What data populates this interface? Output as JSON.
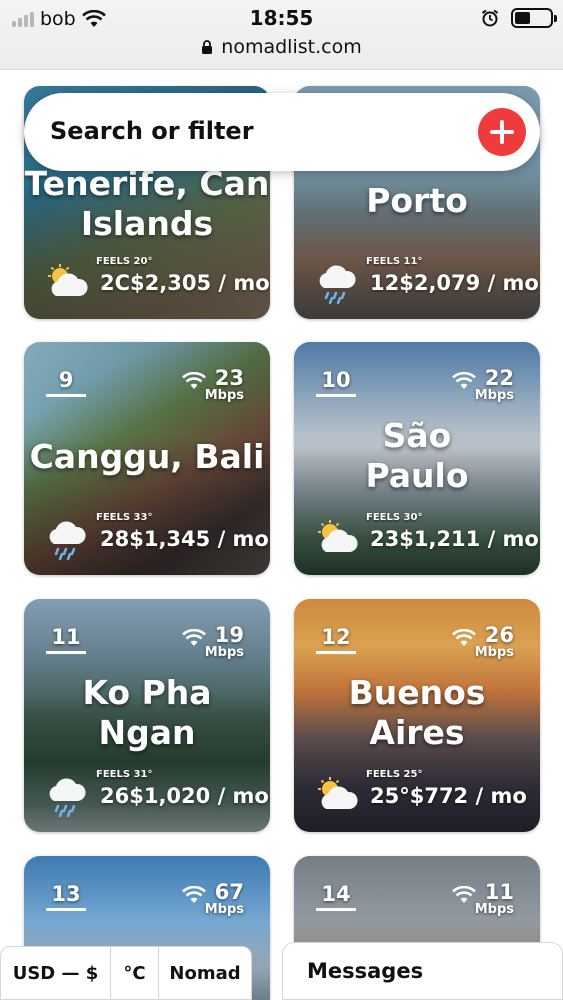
{
  "status_bar": {
    "carrier": "bob",
    "time": "18:55",
    "url": "nomadlist.com",
    "battery_level": 0.45
  },
  "search": {
    "label": "Search or filter",
    "add_icon": "plus-icon",
    "accent_color": "#ef3b3b"
  },
  "cities": [
    {
      "rank": "",
      "name_line1": "Tenerife, Can",
      "name_line2": "Islands",
      "wifi_speed": "",
      "wifi_unit": "",
      "feels": "FEELS 20°",
      "cost": "2C$2,305 / mo",
      "weather_icon": "partly-cloudy-icon"
    },
    {
      "rank": "",
      "name_line1": "Porto",
      "name_line2": "",
      "wifi_speed": "",
      "wifi_unit": "",
      "feels": "FEELS 11°",
      "cost": "12$2,079 / mo",
      "weather_icon": "rain-cloud-icon"
    },
    {
      "rank": "9",
      "name_line1": "Canggu, Bali",
      "name_line2": "",
      "wifi_speed": "23",
      "wifi_unit": "Mbps",
      "feels": "FEELS 33°",
      "cost": "28$1,345 / mo",
      "weather_icon": "rain-cloud-icon"
    },
    {
      "rank": "10",
      "name_line1": "São",
      "name_line2": "Paulo",
      "wifi_speed": "22",
      "wifi_unit": "Mbps",
      "feels": "FEELS 30°",
      "cost": "23$1,211 / mo",
      "weather_icon": "partly-cloudy-icon"
    },
    {
      "rank": "11",
      "name_line1": "Ko Pha",
      "name_line2": "Ngan",
      "wifi_speed": "19",
      "wifi_unit": "Mbps",
      "feels": "FEELS 31°",
      "cost": "26$1,020 / mo",
      "weather_icon": "rain-cloud-icon"
    },
    {
      "rank": "12",
      "name_line1": "Buenos",
      "name_line2": "Aires",
      "wifi_speed": "26",
      "wifi_unit": "Mbps",
      "feels": "FEELS 25°",
      "cost": "25°$772 / mo",
      "weather_icon": "partly-cloudy-icon"
    },
    {
      "rank": "13",
      "name_line1": "",
      "name_line2": "",
      "wifi_speed": "67",
      "wifi_unit": "Mbps",
      "feels": "",
      "cost": "",
      "weather_icon": ""
    },
    {
      "rank": "14",
      "name_line1": "",
      "name_line2": "",
      "wifi_speed": "11",
      "wifi_unit": "Mbps",
      "feels": "",
      "cost": "",
      "weather_icon": ""
    }
  ],
  "bottom_bar": {
    "currency": "USD — $",
    "temp_unit": "°C",
    "mode": "Nomad",
    "messages": "Messages"
  }
}
